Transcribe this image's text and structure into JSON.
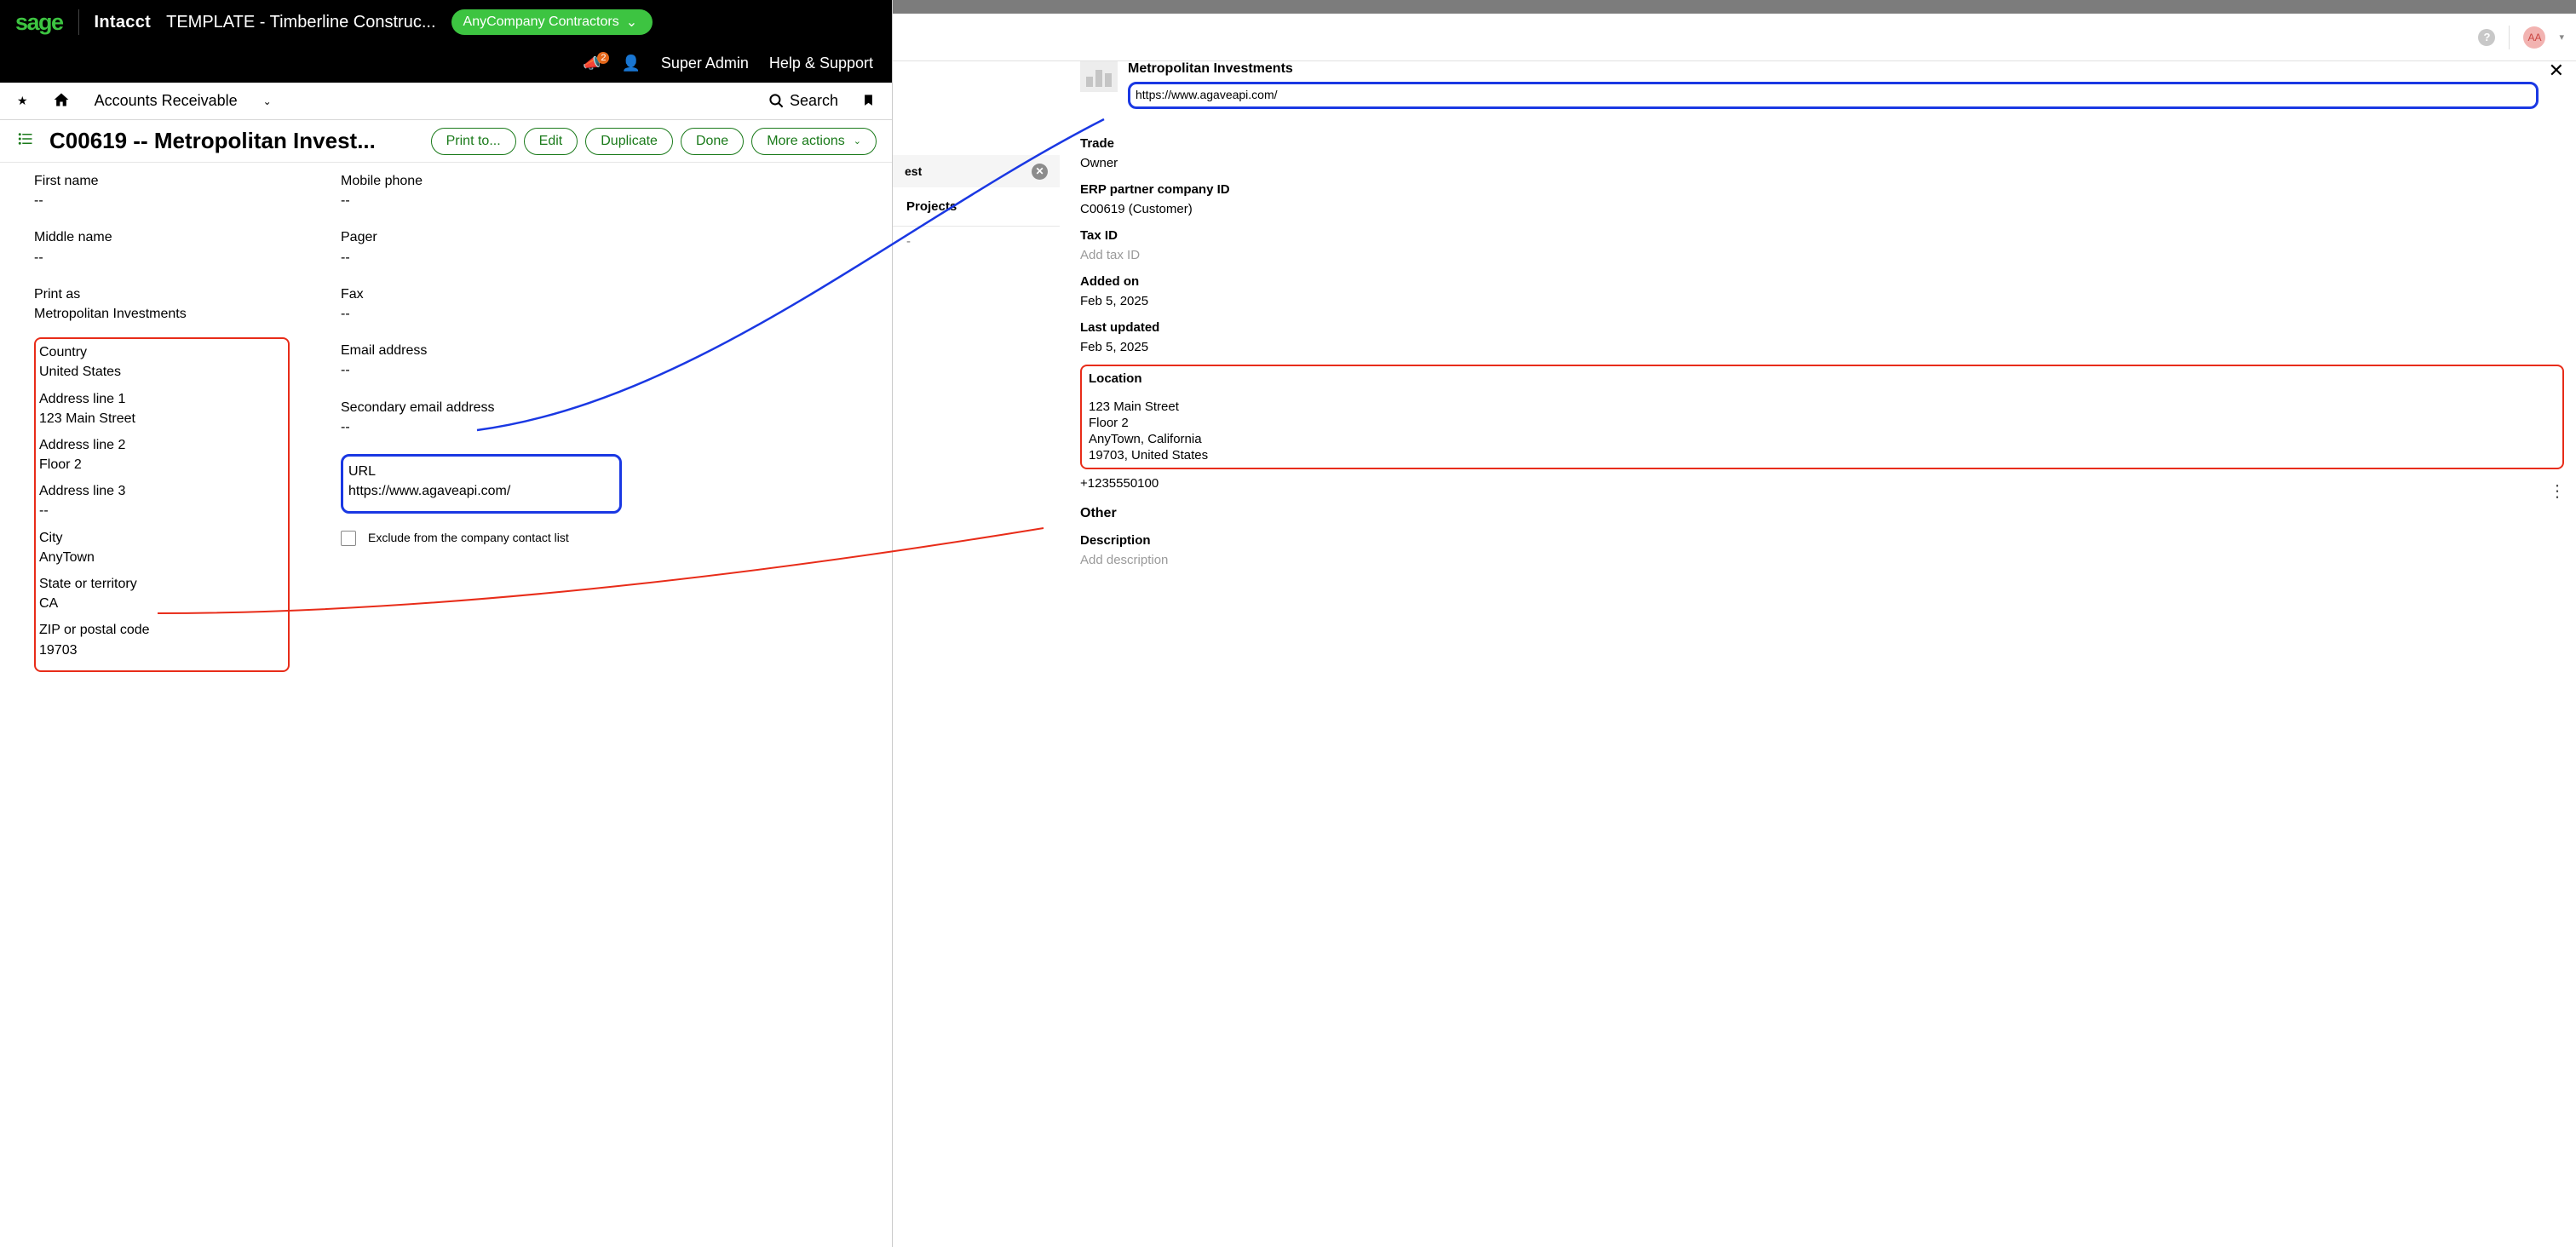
{
  "header": {
    "sage": "sage",
    "intacct": "Intacct",
    "template_title": "TEMPLATE - Timberline Construc...",
    "company_pill": "AnyCompany Contractors",
    "notif_count": "2",
    "user_label": "Super Admin",
    "help_label": "Help & Support"
  },
  "subnav": {
    "module": "Accounts Receivable",
    "search_label": "Search"
  },
  "title_bar": {
    "title": "C00619 -- Metropolitan Invest...",
    "print": "Print to...",
    "edit": "Edit",
    "duplicate": "Duplicate",
    "done": "Done",
    "more": "More actions"
  },
  "left_col": {
    "first_name": {
      "label": "First name",
      "value": "--"
    },
    "middle_name": {
      "label": "Middle name",
      "value": "--"
    },
    "print_as": {
      "label": "Print as",
      "value": "Metropolitan Investments"
    },
    "country": {
      "label": "Country",
      "value": "United States"
    },
    "addr1": {
      "label": "Address line 1",
      "value": "123 Main Street"
    },
    "addr2": {
      "label": "Address line 2",
      "value": "Floor 2"
    },
    "addr3": {
      "label": "Address line 3",
      "value": "--"
    },
    "city": {
      "label": "City",
      "value": "AnyTown"
    },
    "state": {
      "label": "State or territory",
      "value": "CA"
    },
    "zip": {
      "label": "ZIP or postal code",
      "value": "19703"
    }
  },
  "right_col": {
    "mobile": {
      "label": "Mobile phone",
      "value": "--"
    },
    "pager": {
      "label": "Pager",
      "value": "--"
    },
    "fax": {
      "label": "Fax",
      "value": "--"
    },
    "email": {
      "label": "Email address",
      "value": "--"
    },
    "email2": {
      "label": "Secondary email address",
      "value": "--"
    },
    "url": {
      "label": "URL",
      "value": "https://www.agaveapi.com/"
    },
    "exclude": "Exclude from the company contact list"
  },
  "right_app": {
    "avatar": "AA",
    "title": "Metropolitan Investments",
    "url": "https://www.agaveapi.com/",
    "est_tab": "est",
    "projects_tab": "Projects",
    "dash": "-",
    "trade": {
      "label": "Trade",
      "value": "Owner"
    },
    "erp": {
      "label": "ERP partner company ID",
      "value": "C00619 (Customer)"
    },
    "tax": {
      "label": "Tax ID",
      "placeholder": "Add tax ID"
    },
    "added": {
      "label": "Added on",
      "value": "Feb 5, 2025"
    },
    "updated": {
      "label": "Last updated",
      "value": "Feb 5, 2025"
    },
    "location": {
      "label": "Location",
      "line1": "123 Main Street",
      "line2": "Floor 2",
      "line3": "AnyTown, California",
      "line4": "19703, United States"
    },
    "phone": "+1235550100",
    "other": "Other",
    "desc_label": "Description",
    "desc_placeholder": "Add description"
  }
}
